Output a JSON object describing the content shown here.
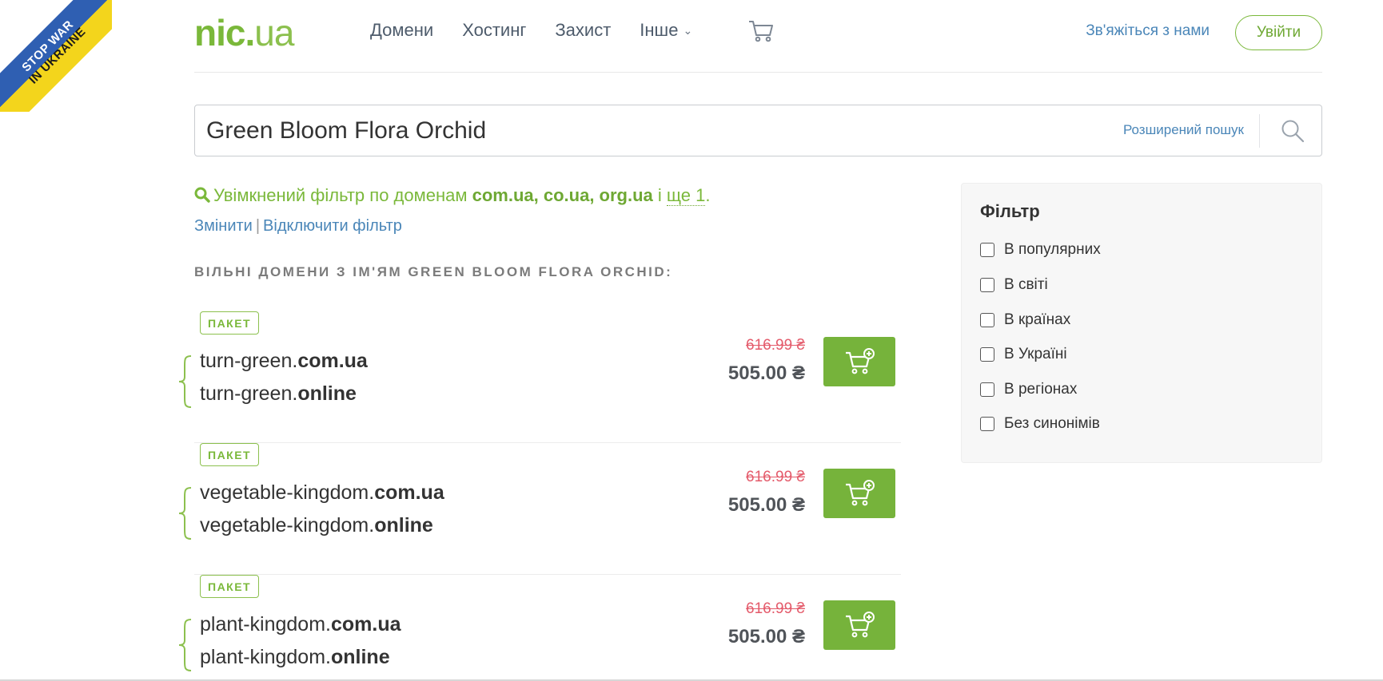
{
  "ribbon": {
    "line1": "STOP WAR",
    "line2": "IN UKRAINE"
  },
  "header": {
    "logo_main": "nic",
    "logo_dot": ".",
    "logo_tld": "ua",
    "nav": [
      "Домени",
      "Хостинг",
      "Захист",
      "Інше"
    ],
    "contact": "Зв'яжіться з нами",
    "login": "Увійти"
  },
  "search": {
    "query": "Green Bloom Flora Orchid",
    "advanced": "Розширений пошук"
  },
  "filter_notice": {
    "prefix": "Увімкнений фільтр по доменам",
    "domains": "com.ua, co.ua, org.ua",
    "and": "і",
    "more": "ще 1",
    "suffix": ".",
    "change": "Змінити",
    "separator": "|",
    "disable": "Відключити фільтр"
  },
  "heading": "ВІЛЬНІ ДОМЕНИ З ІМ'ЯМ GREEN BLOOM FLORA ORCHID:",
  "results": [
    {
      "badge": "ПАКЕТ",
      "name": "turn-green",
      "tld1": "com.ua",
      "tld2": "online",
      "old_price": "616.99 ₴",
      "price": "505.00 ₴"
    },
    {
      "badge": "ПАКЕТ",
      "name": "vegetable-kingdom",
      "tld1": "com.ua",
      "tld2": "online",
      "old_price": "616.99 ₴",
      "price": "505.00 ₴"
    },
    {
      "badge": "ПАКЕТ",
      "name": "plant-kingdom",
      "tld1": "com.ua",
      "tld2": "online",
      "old_price": "616.99 ₴",
      "price": "505.00 ₴"
    }
  ],
  "sidebar": {
    "title": "Фільтр",
    "options": [
      "В популярних",
      "В світі",
      "В країнах",
      "В Україні",
      "В регіонах",
      "Без синонімів"
    ]
  },
  "colors": {
    "brand_green": "#7ab83a",
    "link_blue": "#4a86b8",
    "old_price_red": "#e45b6b",
    "button_green": "#76b33b"
  }
}
